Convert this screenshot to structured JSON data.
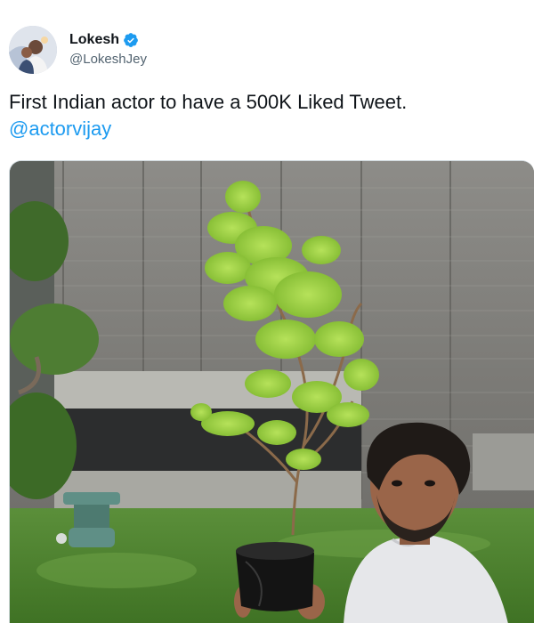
{
  "tweet": {
    "author": {
      "display_name": "Lokesh",
      "handle": "@LokeshJey",
      "verified": true,
      "verified_color": "#1d9bf0"
    },
    "text": "First Indian actor to have a 500K Liked Tweet.",
    "mention": "@actorvijay",
    "mention_color": "#1d9bf0",
    "media": {
      "kind": "photo"
    }
  }
}
